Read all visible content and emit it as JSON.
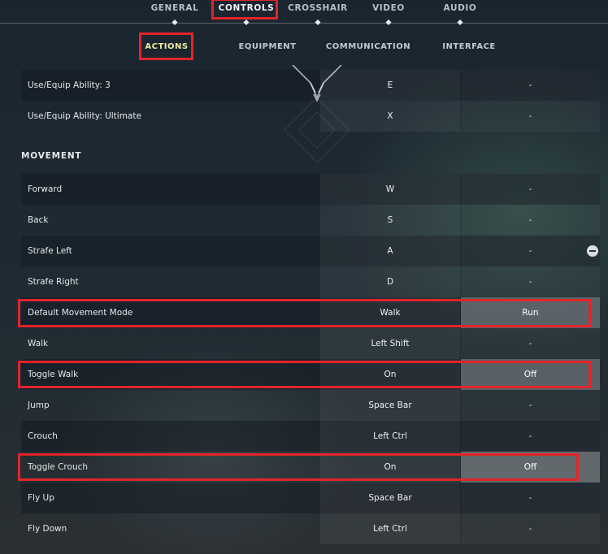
{
  "top_tabs": {
    "general": "GENERAL",
    "controls": "CONTROLS",
    "crosshair": "CROSSHAIR",
    "video": "VIDEO",
    "audio": "AUDIO"
  },
  "sub_tabs": {
    "actions": "ACTIONS",
    "equipment": "EQUIPMENT",
    "communication": "COMMUNICATION",
    "interface": "INTERFACE"
  },
  "ability_rows": [
    {
      "label": "Use/Equip Ability: 3",
      "primary": "E",
      "secondary": "-"
    },
    {
      "label": "Use/Equip Ability: Ultimate",
      "primary": "X",
      "secondary": "-"
    }
  ],
  "movement": {
    "title": "MOVEMENT",
    "rows": [
      {
        "label": "Forward",
        "primary": "W",
        "secondary": "-"
      },
      {
        "label": "Back",
        "primary": "S",
        "secondary": "-"
      },
      {
        "label": "Strafe Left",
        "primary": "A",
        "secondary": "-"
      },
      {
        "label": "Strafe Right",
        "primary": "D",
        "secondary": "-"
      },
      {
        "label": "Default Movement Mode",
        "primary": "Walk",
        "secondary": "Run"
      },
      {
        "label": "Walk",
        "primary": "Left Shift",
        "secondary": "-"
      },
      {
        "label": "Toggle Walk",
        "primary": "On",
        "secondary": "Off"
      },
      {
        "label": "Jump",
        "primary": "Space Bar",
        "secondary": "-"
      },
      {
        "label": "Crouch",
        "primary": "Left Ctrl",
        "secondary": "-"
      },
      {
        "label": "Toggle Crouch",
        "primary": "On",
        "secondary": "Off"
      },
      {
        "label": "Fly Up",
        "primary": "Space Bar",
        "secondary": "-"
      },
      {
        "label": "Fly Down",
        "primary": "Left Ctrl",
        "secondary": "-"
      }
    ]
  },
  "colors": {
    "highlight": "#e3242b",
    "active_sub_tab": "#f1e89a"
  },
  "icons": {
    "row_action": "minus-circle-icon",
    "emblem": "valorant-emblem-icon"
  }
}
